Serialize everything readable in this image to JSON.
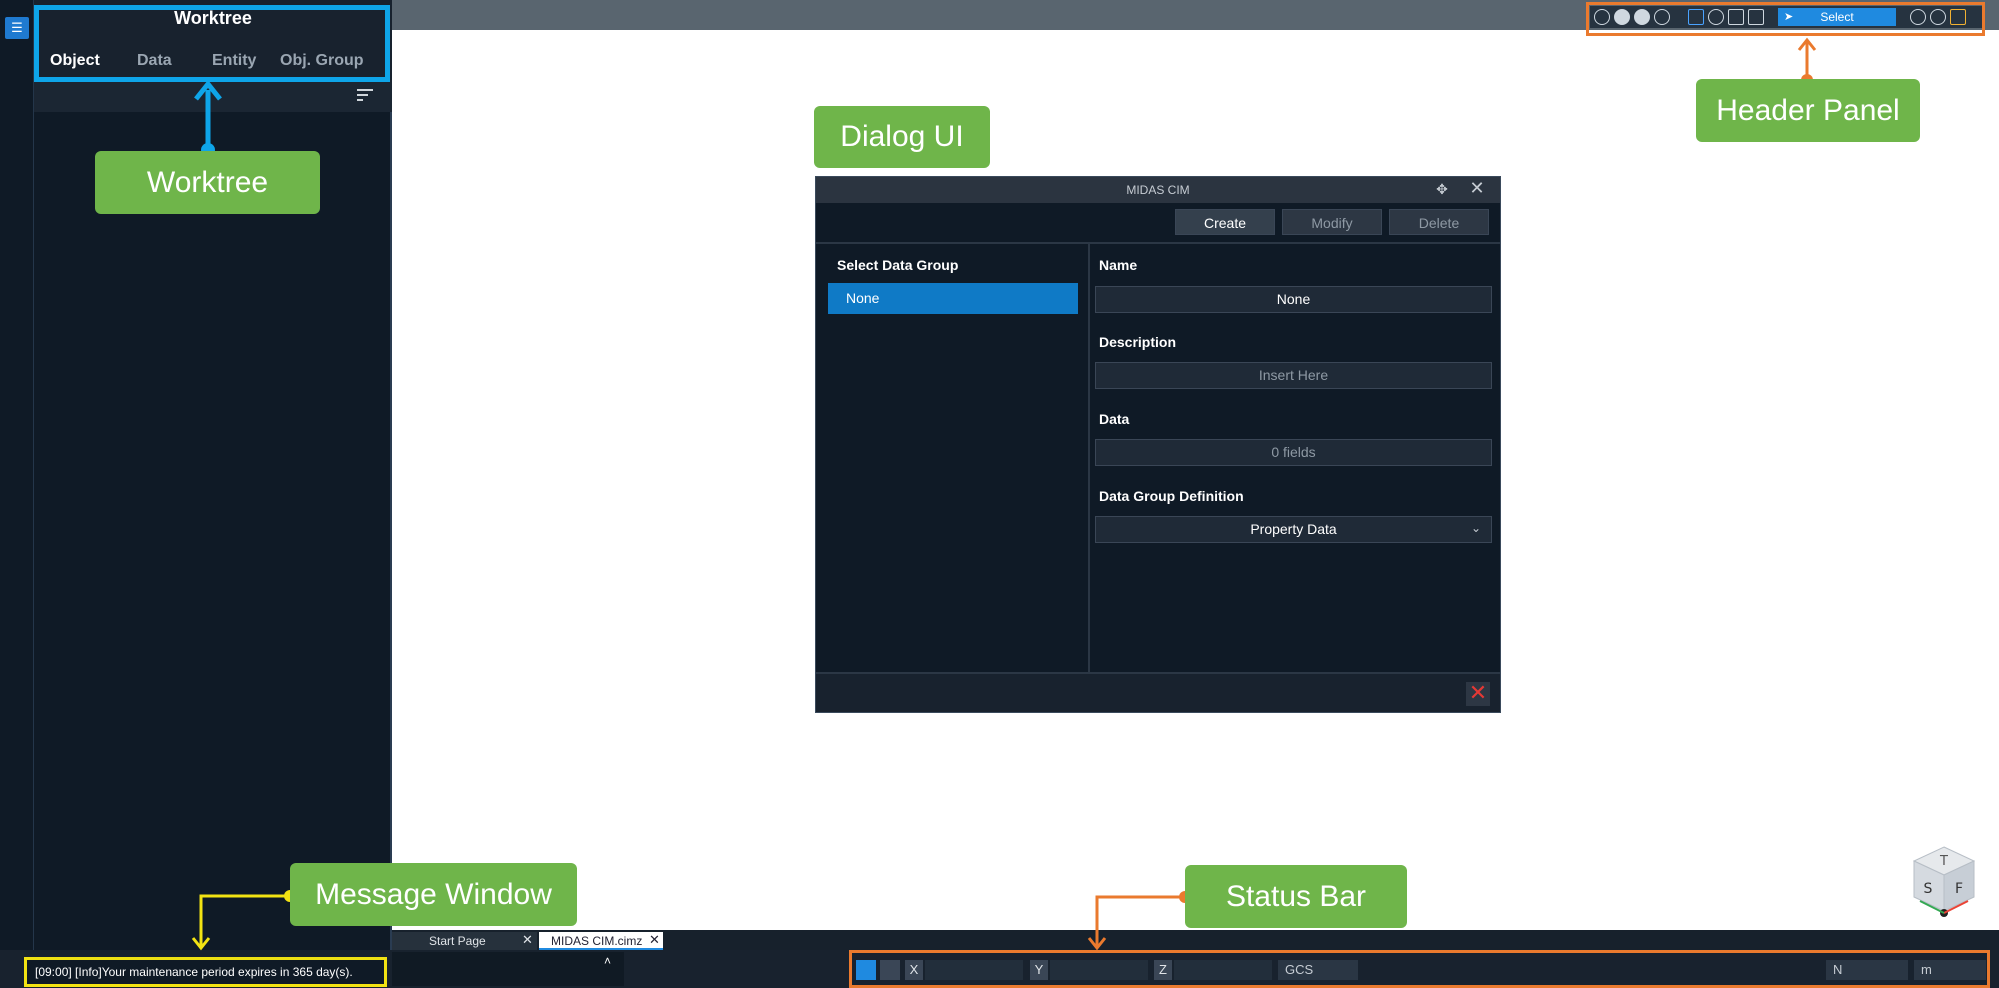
{
  "worktree": {
    "title": "Worktree",
    "tabs": [
      "Object",
      "Data",
      "Entity",
      "Obj. Group"
    ]
  },
  "header_panel": {
    "select_label": "Select"
  },
  "dialog": {
    "title": "MIDAS CIM",
    "buttons": {
      "create": "Create",
      "modify": "Modify",
      "delete": "Delete"
    },
    "select_data_group_label": "Select Data Group",
    "selected_group": "None",
    "fields": {
      "name_label": "Name",
      "name_value": "None",
      "description_label": "Description",
      "description_placeholder": "Insert Here",
      "data_label": "Data",
      "data_value": "0 fields",
      "definition_label": "Data Group Definition",
      "definition_value": "Property Data"
    }
  },
  "document_tabs": [
    "Start Page",
    "MIDAS CIM.cimz"
  ],
  "message_window": {
    "text": "[09:00] [Info]Your maintenance period expires in 365 day(s)."
  },
  "status_bar": {
    "axis_x": "X",
    "axis_y": "Y",
    "axis_z": "Z",
    "coord_system": "GCS",
    "force_unit": "N",
    "length_unit": "m"
  },
  "callouts": {
    "worktree": "Worktree",
    "dialog": "Dialog UI",
    "header": "Header Panel",
    "message": "Message Window",
    "status": "Status Bar"
  },
  "colors": {
    "worktree_outline": "#0ea5e9",
    "header_status_outline": "#ea7a2e",
    "message_outline": "#f2e313",
    "callout_bg": "#6fb54a",
    "selection_blue": "#0f7ac6"
  },
  "view_cube_faces": [
    "T",
    "S",
    "F"
  ]
}
